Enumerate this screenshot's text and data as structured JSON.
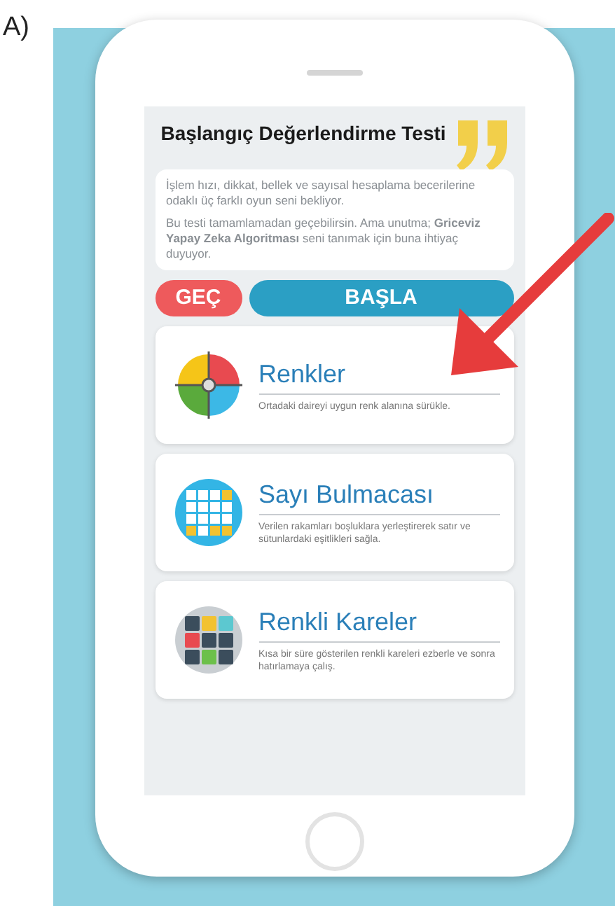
{
  "figure_label": "A)",
  "screen": {
    "title": "Başlangıç Değerlendirme Testi",
    "intro": [
      "İşlem hızı, dikkat, bellek ve sayısal hesaplama becerilerine odaklı üç farklı oyun seni bekliyor.",
      "Bu testi tamamlamadan geçebilirsin. Ama unutma; **Griceviz Yapay Zeka Algoritması** seni tanımak için buna ihtiyaç duyuyor."
    ],
    "buttons": [
      {
        "label": "GEÇ",
        "kind": "skip"
      },
      {
        "label": "BAŞLA",
        "kind": "start"
      }
    ],
    "games": [
      {
        "kind": "colors",
        "title": "Renkler",
        "description": "Ortadaki daireyi uygun renk alanına sürükle."
      },
      {
        "kind": "numbers",
        "title": "Sayı Bulmacası",
        "description": "Verilen rakamları boşluklara yerleştirerek satır ve sütunlardaki eşitlikleri sağla."
      },
      {
        "kind": "squares",
        "title": "Renkli Kareler",
        "description": "Kısa bir süre gösterilen renkli kareleri ezberle ve sonra hatırlamaya çalış."
      }
    ]
  }
}
